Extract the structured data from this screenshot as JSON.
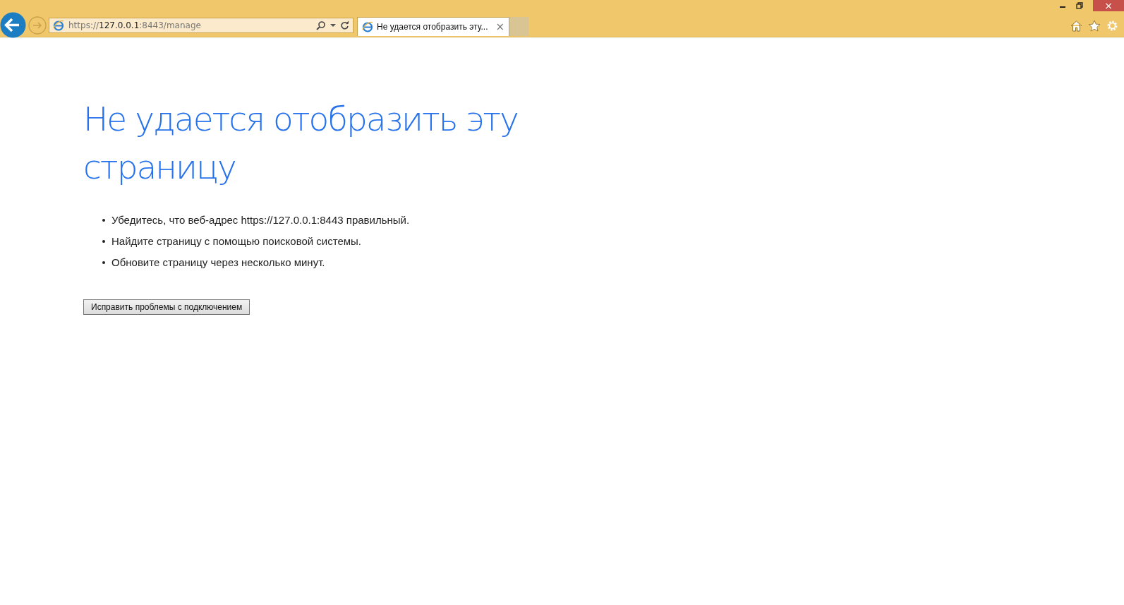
{
  "address_bar": {
    "scheme": "https://",
    "host": "127.0.0.1",
    "path": ":8443/manage"
  },
  "tabs": [
    {
      "label": "Не удается отобразить эту...",
      "selected": true,
      "close": "×"
    }
  ],
  "window_controls": {
    "close": "×"
  },
  "heading": "Не удается отобразить эту страницу",
  "suggestions": [
    "Убедитесь, что веб-адрес https://127.0.0.1:8443 правильный.",
    "Найдите страницу с помощью поисковой системы.",
    "Обновите страницу через несколько минут."
  ],
  "button": "Исправить проблемы с подключением"
}
